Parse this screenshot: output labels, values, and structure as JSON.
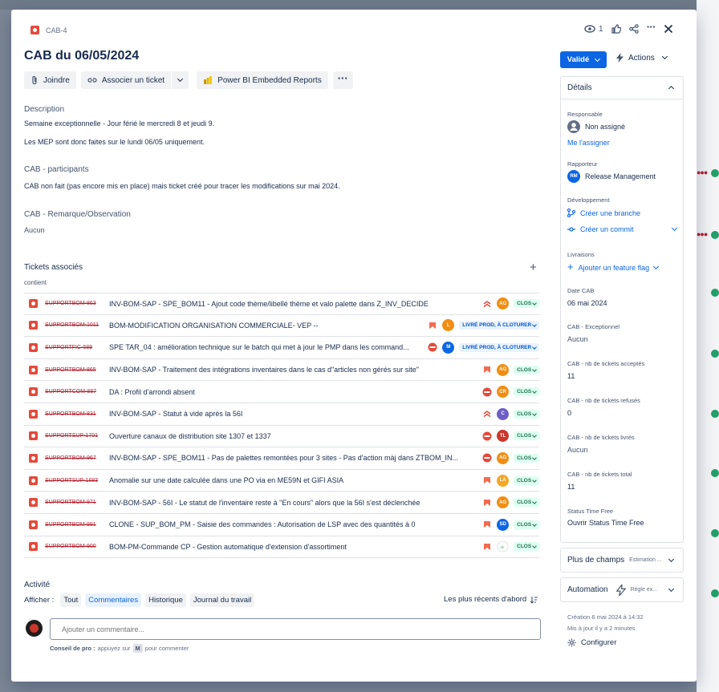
{
  "header": {
    "issue_key": "CAB-4",
    "title": "CAB du 06/05/2024",
    "watch_count": "1"
  },
  "toolbar": {
    "join": "Joindre",
    "link_ticket": "Associer un ticket",
    "powerbi": "Power BI Embedded Reports"
  },
  "description": {
    "label": "Description",
    "line1": "Semaine exceptionnelle - Jour férié le mercredi 8 et jeudi 9.",
    "line2": "Les MEP sont donc faites sur le lundi 06/05 uniquement."
  },
  "participants": {
    "label": "CAB - participants",
    "text": "CAB non fait (pas encore mis en place) mais ticket créé pour tracer les modifications sur mai 2024."
  },
  "remarks": {
    "label": "CAB - Remarque/Observation",
    "text": "Aucun"
  },
  "linked": {
    "label": "Tickets associés",
    "relation": "contient",
    "tickets": [
      {
        "key": "SUPPORTBOM-863",
        "summary": "INV-BOM-SAP - SPE_BOM11 - Ajout code thème/libellé thème et valo palette dans Z_INV_DECIDE",
        "priority": "highest",
        "assignee": "AG",
        "avatar_color": "#f18d13",
        "status": "CLOS"
      },
      {
        "key": "SUPPORTBOM-1011",
        "summary": "BOM-MODIFICATION ORGANISATION COMMERCIALE- VEP --",
        "priority": "high",
        "assignee": "L",
        "avatar_color": "#f18d13",
        "status": "LIVRÉ PROD, À CLOTURER"
      },
      {
        "key": "SUPPORTFIC-589",
        "summary": "SPE TAR_04 : amélioration technique sur le batch qui met à jour le PMP dans les command...",
        "priority": "blocker",
        "assignee": "M",
        "avatar_color": "#0c66e4",
        "status": "LIVRÉ PROD, À CLOTURER"
      },
      {
        "key": "SUPPORTBOM-865",
        "summary": "INV-BOM-SAP - Traitement des intégrations inventaires dans le cas d\"articles non gérés sur site\"",
        "priority": "high",
        "assignee": "AG",
        "avatar_color": "#f18d13",
        "status": "CLOS"
      },
      {
        "key": "SUPPORTCOM-887",
        "summary": "DA : Profil d'arrondi absent",
        "priority": "blocker",
        "assignee": "CR",
        "avatar_color": "#f18d13",
        "status": "CLOS"
      },
      {
        "key": "SUPPORTBOM-831",
        "summary": "INV-BOM-SAP - Statut à vide après la 56I",
        "priority": "highest",
        "assignee": "C",
        "avatar_color": "#6e5dc6",
        "status": "CLOS"
      },
      {
        "key": "SUPPORTSUP-1701",
        "summary": "Ouverture canaux de distribution site 1307 et 1337",
        "priority": "blocker",
        "assignee": "TL",
        "avatar_color": "#c9372c",
        "status": "CLOS"
      },
      {
        "key": "SUPPORTBOM-967",
        "summary": "INV-BOM-SAP - SPE_BOM11 - Pas de palettes remontées pour 3 sites - Pas d'action màj dans ZTBOM_IN...",
        "priority": "blocker",
        "assignee": "AG",
        "avatar_color": "#f18d13",
        "status": "CLOS"
      },
      {
        "key": "SUPPORTSUP-1683",
        "summary": "Anomalie sur une date calculée dans une PO via en ME59N et GIFI ASIA",
        "priority": "high",
        "assignee": "LA",
        "avatar_color": "#f5a623",
        "status": "CLOS"
      },
      {
        "key": "SUPPORTBOM-971",
        "summary": "INV-BOM-SAP - 56I - Le statut de l'inventaire reste à \"En cours\" alors que la 56I s'est déclenchée",
        "priority": "high",
        "assignee": "AG",
        "avatar_color": "#f18d13",
        "status": "CLOS"
      },
      {
        "key": "SUPPORTBOM-991",
        "summary": "CLONE - SUP_BOM_PM - Saisie des commandes : Autorisation de LSP avec des quantités à 0",
        "priority": "high",
        "assignee": "SD",
        "avatar_color": "#0c66e4",
        "status": "CLOS"
      },
      {
        "key": "SUPPORTBOM-900",
        "summary": "BOM-PM-Commande CP - Gestion automatique d'extension d'assortiment",
        "priority": "high",
        "assignee": "",
        "avatar_color": "#ffffff",
        "status": "CLOS"
      }
    ]
  },
  "activity": {
    "label": "Activité",
    "show_label": "Afficher :",
    "filters": [
      "Tout",
      "Commentaires",
      "Historique",
      "Journal du travail"
    ],
    "sort": "Les plus récents d'abord",
    "comment_placeholder": "Ajouter un commentaire...",
    "tip_bold": "Conseil de pro :",
    "tip_text_before": "appuyez sur",
    "tip_key": "M",
    "tip_text_after": "pour commenter"
  },
  "sidebar": {
    "status_button": "Validé",
    "actions": "Actions",
    "details": "Détails",
    "assignee_label": "Responsable",
    "assignee_value": "Non assigné",
    "assign_me": "Me l'assigner",
    "reporter_label": "Rapporteur",
    "reporter_initials": "RM",
    "reporter_value": "Release Management",
    "dev_label": "Développement",
    "create_branch": "Créer une branche",
    "create_commit": "Créer un commit",
    "deliveries_label": "Livraisons",
    "add_flag": "Ajouter un feature flag",
    "date_label": "Date CAB",
    "date_value": "06 mai 2024",
    "exceptional_label": "CAB - Exceptionnel",
    "exceptional_value": "Aucun",
    "accepted_label": "CAB - nb de tickets acceptés",
    "accepted_value": "11",
    "refused_label": "CAB - nb de tickets refusés",
    "refused_value": "0",
    "delivered_label": "CAB - nb de tickets livrés",
    "delivered_value": "Aucun",
    "total_label": "CAB - nb de tickets total",
    "total_value": "11",
    "stf_label": "Status Time Free",
    "stf_value": "Ouvrir Status Time Free",
    "more_fields": "Plus de champs",
    "more_fields_hint": "Estimation ...",
    "automation": "Automation",
    "automation_hint": "Règle ex...",
    "created": "Création 6 mai 2024 à 14:32",
    "updated": "Mis à jour il y a 2 minutes",
    "configure": "Configurer"
  },
  "colors": {
    "primary": "#0c66e4",
    "bug": "#e5493a",
    "clos_bg": "#dcfff1",
    "livre_bg": "#e9f2ff"
  }
}
